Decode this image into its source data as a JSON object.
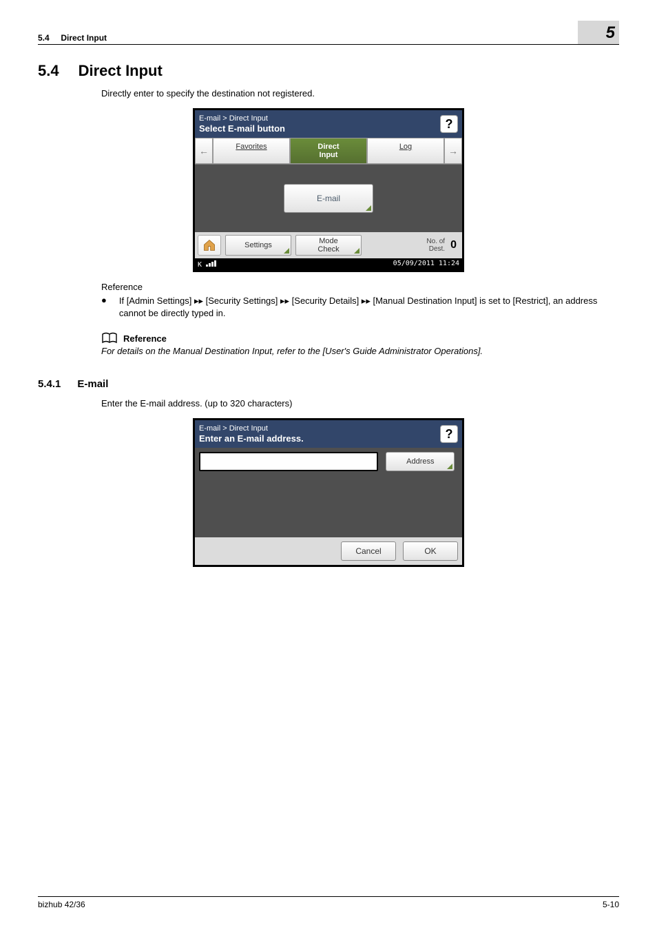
{
  "header": {
    "section_num": "5.4",
    "section_title": "Direct Input",
    "chapter_badge": "5"
  },
  "h2": {
    "num": "5.4",
    "title": "Direct Input"
  },
  "intro_para": "Directly enter to specify the destination not registered.",
  "screen1": {
    "breadcrumb": "E-mail > Direct Input",
    "prompt": "Select E-mail button",
    "help": "?",
    "tab_favorites": "Favorites",
    "tab_direct_input": "Direct\nInput",
    "tab_log": "Log",
    "center_button": "E-mail",
    "footer_settings": "Settings",
    "footer_mode_check": "Mode\nCheck",
    "footer_dest_label": "No. of\nDest.",
    "footer_dest_count": "0",
    "status_left": "K",
    "status_right": "05/09/2011 11:24"
  },
  "reference": {
    "label": "Reference",
    "bullet_text": "If [Admin Settings] ▸▸ [Security Settings] ▸▸ [Security Details] ▸▸ [Manual Destination Input] is set to [Restrict], an address cannot be directly typed in."
  },
  "book_ref": {
    "heading": "Reference",
    "text": "For details on the Manual Destination Input, refer to the [User's Guide Administrator Operations]."
  },
  "h3": {
    "num": "5.4.1",
    "title": "E-mail"
  },
  "h3_para": "Enter the E-mail address. (up to 320 characters)",
  "screen2": {
    "breadcrumb": "E-mail > Direct Input",
    "prompt": "Enter an E-mail address.",
    "help": "?",
    "address_button": "Address",
    "cancel": "Cancel",
    "ok": "OK"
  },
  "footer": {
    "left": "bizhub 42/36",
    "right": "5-10"
  }
}
